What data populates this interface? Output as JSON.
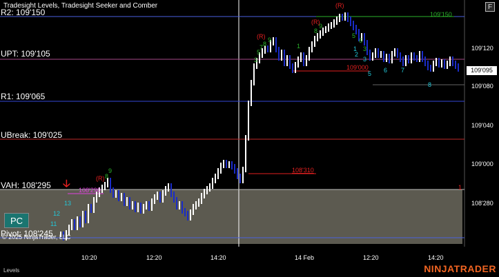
{
  "title": "Tradesight Levels, Tradesight Seeker and Comber",
  "f_button": "F",
  "bottom_tab": "Levels",
  "brand_a": "NINJA",
  "brand_b": "TRADER",
  "pc_label": "PC",
  "copyright": "© 2025 NinjaTrader, LLC",
  "colors": {
    "up_bar": "#ffffff",
    "down_bar": "#1a2cc8",
    "accent_red": "#e52020",
    "brand_orange": "#f26522",
    "value_area": "#5c5a50",
    "seeker_green": "#2bb32b",
    "seeker_cyan": "#22c7d8"
  },
  "levels": [
    {
      "label": "R2: 109'150",
      "color": "#4a61e0"
    },
    {
      "label": "UPT: 109'105",
      "color": "#a64a8a"
    },
    {
      "label": "R1: 109'065",
      "color": "#3548d8"
    },
    {
      "label": "UBreak: 109'025",
      "color": "#c02a2a"
    },
    {
      "label": "VAH: 108'295",
      "color": "#bdbdbd"
    },
    {
      "label": "Pivot: 108'245",
      "color": "#4a61e0"
    }
  ],
  "price_axis": [
    "109'120",
    "109'080",
    "109'040",
    "109'000",
    "108'280"
  ],
  "current_price": "109'095",
  "time_axis": [
    "10:20",
    "12:20",
    "14:20",
    "14 Feb",
    "12:20",
    "14:20"
  ],
  "line_labels": [
    {
      "text": "108'310",
      "color": "#e52020"
    },
    {
      "text": "108'290",
      "color": "#e040e0"
    },
    {
      "text": "109'150",
      "color": "#2bb32b"
    },
    {
      "text": "109'000",
      "color": "#e52020"
    }
  ],
  "signals": [
    {
      "text": "(R)",
      "color": "#e52020"
    },
    {
      "text": "(R)",
      "color": "#e52020"
    },
    {
      "text": "(R)",
      "color": "#e52020"
    },
    {
      "text": "(R)",
      "color": "#e52020"
    },
    {
      "text": "9",
      "color": "#2bb32b"
    },
    {
      "text": "8",
      "color": "#2bb32b"
    },
    {
      "text": "9",
      "color": "#2bb32b"
    },
    {
      "text": "8",
      "color": "#2bb32b"
    },
    {
      "text": "7",
      "color": "#2bb32b"
    },
    {
      "text": "5",
      "color": "#2bb32b"
    },
    {
      "text": "3",
      "color": "#2bb32b"
    },
    {
      "text": "1",
      "color": "#2bb32b"
    },
    {
      "text": "8",
      "color": "#2bb32b"
    },
    {
      "text": "9",
      "color": "#2bb32b"
    },
    {
      "text": "5",
      "color": "#2bb32b"
    },
    {
      "text": "6",
      "color": "#2bb32b"
    },
    {
      "text": "3",
      "color": "#2bb32b"
    },
    {
      "text": "13",
      "color": "#22c7d8"
    },
    {
      "text": "12",
      "color": "#22c7d8"
    },
    {
      "text": "11",
      "color": "#22c7d8"
    },
    {
      "text": "1",
      "color": "#22c7d8"
    },
    {
      "text": "2",
      "color": "#22c7d8"
    },
    {
      "text": "3",
      "color": "#22c7d8"
    },
    {
      "text": "5",
      "color": "#22c7d8"
    },
    {
      "text": "6",
      "color": "#22c7d8"
    },
    {
      "text": "7",
      "color": "#22c7d8"
    },
    {
      "text": "8",
      "color": "#22c7d8"
    },
    {
      "text": "1",
      "color": "#e52020"
    }
  ],
  "chart_data": {
    "type": "candlestick",
    "x_ticks": [
      "10:20",
      "12:20",
      "14:20",
      "14 Feb",
      "12:20",
      "14:20"
    ],
    "y_ticks": [
      "108'280",
      "109'000",
      "109'040",
      "109'080",
      "109'120"
    ],
    "bars_close_approx": [
      108.245,
      108.25,
      108.255,
      108.26,
      108.27,
      108.28,
      108.285,
      108.29,
      108.285,
      108.28,
      108.275,
      108.27,
      108.272,
      108.275,
      108.28,
      108.285,
      108.29,
      108.295,
      108.3,
      109.01,
      109.05,
      109.08,
      109.1,
      109.11,
      109.105,
      109.12,
      109.13,
      109.14,
      109.15,
      109.14,
      109.13,
      109.12,
      109.11,
      109.1,
      109.105,
      109.1,
      109.095
    ]
  }
}
